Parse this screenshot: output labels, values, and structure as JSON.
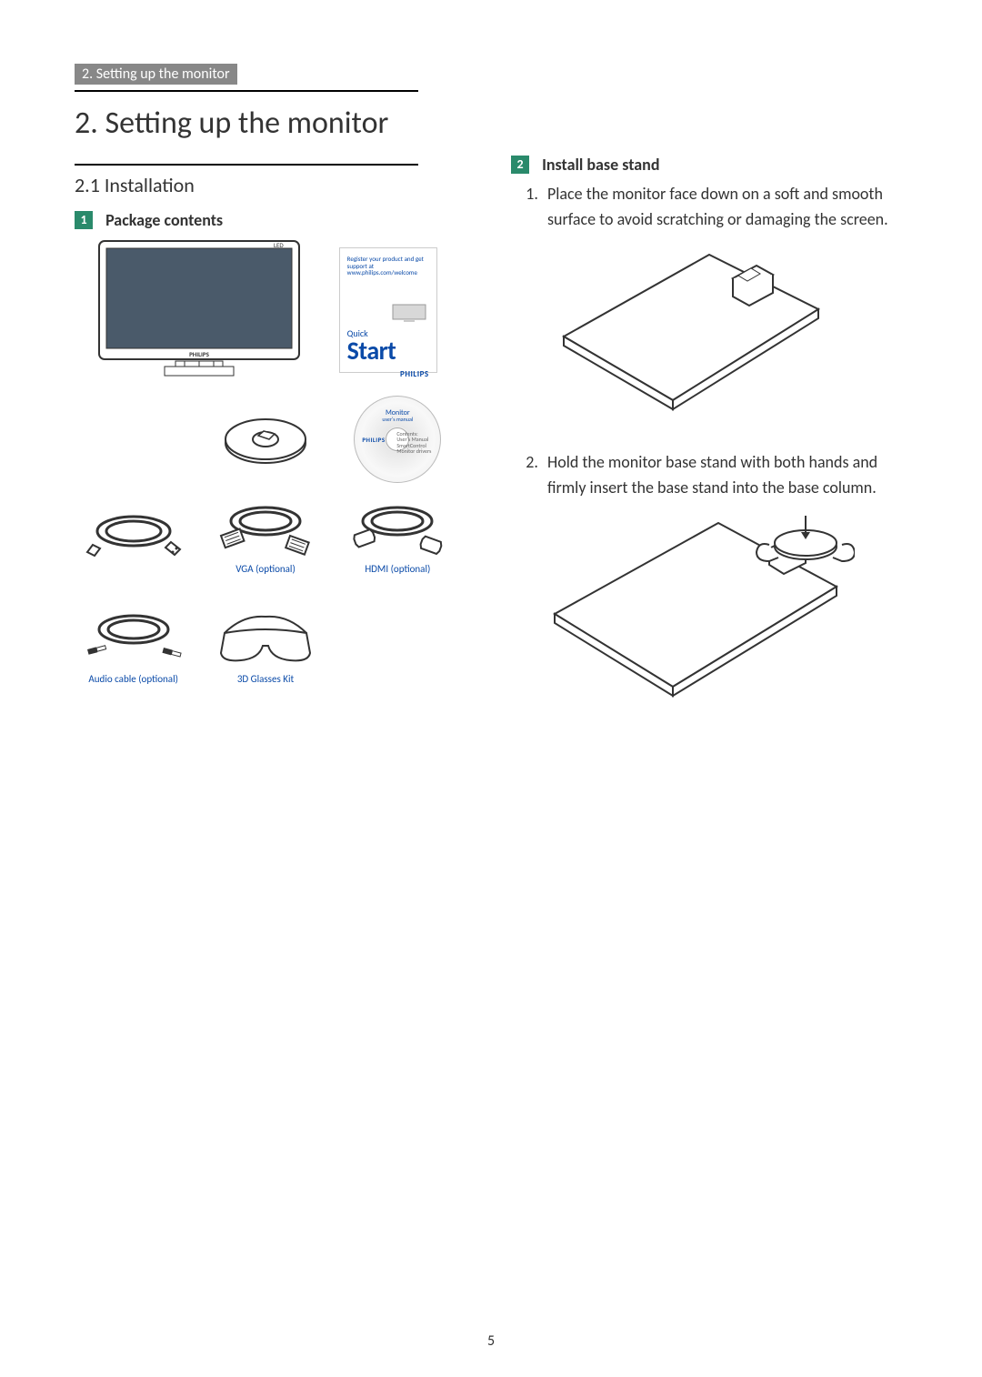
{
  "header": {
    "running": "2. Setting up the monitor"
  },
  "chapter": {
    "title": "2.  Setting up the monitor"
  },
  "section": {
    "number_title": "2.1  Installation"
  },
  "left": {
    "step1": {
      "num": "1",
      "title": "Package contents"
    },
    "quickstart": {
      "register": "Register your product and get support at",
      "url": "www.philips.com/welcome",
      "quick": "Quick",
      "start": "Start",
      "brand": "PHILIPS"
    },
    "cd": {
      "title": "Monitor",
      "subtitle": "user's manual",
      "brand": "PHILIPS",
      "side": "Contents:\nUser's Manual\nSmartControl\nMonitor drivers"
    },
    "labels": {
      "vga": "VGA (optional)",
      "hdmi": "HDMI (optional)",
      "audio": "Audio cable (optional)",
      "glasses": "3D Glasses Kit"
    },
    "monitor_brand": "PHILIPS"
  },
  "right": {
    "step2": {
      "num": "2",
      "title": "Install base stand"
    },
    "instructions": [
      "Place the monitor face down on a soft and smooth surface to avoid scratching or damaging the screen.",
      "Hold the monitor base stand with both hands and firmly insert the base stand into the base column."
    ]
  },
  "page_number": "5"
}
